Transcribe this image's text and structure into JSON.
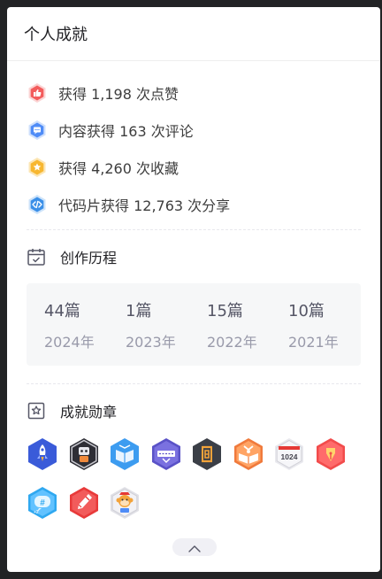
{
  "header": {
    "title": "个人成就"
  },
  "achievements": [
    {
      "icon": "thumbs-up-icon",
      "text": "获得 1,198 次点赞",
      "color": "#f35c5c"
    },
    {
      "icon": "comment-icon",
      "text": "内容获得 163 次评论",
      "color": "#4f8cf7"
    },
    {
      "icon": "star-icon",
      "text": "获得 4,260 次收藏",
      "color": "#f7b731"
    },
    {
      "icon": "code-icon",
      "text": "代码片获得 12,763 次分享",
      "color": "#3a8fe8"
    }
  ],
  "history": {
    "title": "创作历程",
    "items": [
      {
        "count": "44篇",
        "year": "2024年"
      },
      {
        "count": "1篇",
        "year": "2023年"
      },
      {
        "count": "15篇",
        "year": "2022年"
      },
      {
        "count": "10篇",
        "year": "2021年"
      }
    ]
  },
  "badges": {
    "title": "成就勋章",
    "items": [
      {
        "name": "rocket-badge-icon",
        "color": "#3a5bd9"
      },
      {
        "name": "robot-badge-icon",
        "color": "#2e2e35"
      },
      {
        "name": "book-badge-icon",
        "color": "#3d9cf0"
      },
      {
        "name": "blogger-badge-icon",
        "color": "#5a52c7",
        "label": "博客专家"
      },
      {
        "name": "persistence-badge-icon",
        "color": "#3b3f47",
        "label": "恒"
      },
      {
        "name": "reader-badge-icon",
        "color": "#f07a3c"
      },
      {
        "name": "1024-badge-icon",
        "color": "#e9e9ee",
        "label": "1024"
      },
      {
        "name": "pen-gift-badge-icon",
        "color": "#f24c4c"
      },
      {
        "name": "topic-badge-icon",
        "color": "#2fa8f0",
        "label": "#"
      },
      {
        "name": "pen-badge-icon",
        "color": "#e83a3a"
      },
      {
        "name": "monkey-badge-icon",
        "color": "#e0e0e6"
      }
    ]
  },
  "expand": {
    "icon": "chevron-up-icon"
  }
}
